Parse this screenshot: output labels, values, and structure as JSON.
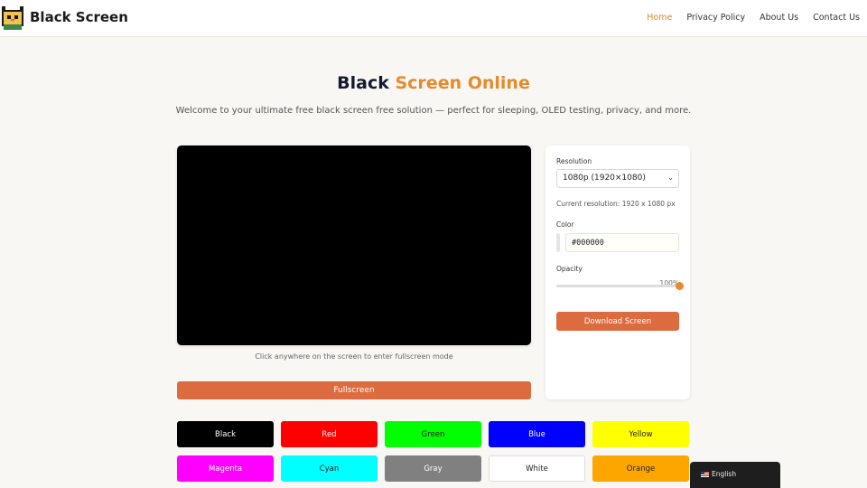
{
  "header": {
    "brand": "Black Screen",
    "nav": [
      {
        "label": "Home",
        "active": true
      },
      {
        "label": "Privacy Policy",
        "active": false
      },
      {
        "label": "About Us",
        "active": false
      },
      {
        "label": "Contact Us",
        "active": false
      }
    ]
  },
  "hero": {
    "title_main": "Black",
    "title_accent": "Screen Online",
    "subtitle": "Welcome to your ultimate free black screen free solution — perfect for sleeping, OLED testing, privacy, and more."
  },
  "preview": {
    "color": "#000000",
    "hint": "Click anywhere on the screen to enter fullscreen mode",
    "fullscreen_label": "Fullscreen"
  },
  "controls": {
    "resolution_label": "Resolution",
    "resolution_value": "1080p (1920×1080)",
    "current_resolution": "Current resolution: 1920 x 1080 px",
    "color_label": "Color",
    "color_value": "#000000",
    "opacity_label": "Opacity",
    "opacity_value": "100%",
    "opacity_fraction": 1.0,
    "download_label": "Download Screen"
  },
  "color_buttons": [
    {
      "label": "Black",
      "bg": "#000000",
      "fg": "#ffffff"
    },
    {
      "label": "Red",
      "bg": "#ff0000",
      "fg": "#ffffff"
    },
    {
      "label": "Green",
      "bg": "#00ff00",
      "fg": "#222222"
    },
    {
      "label": "Blue",
      "bg": "#0000ff",
      "fg": "#ffffff"
    },
    {
      "label": "Yellow",
      "bg": "#ffff00",
      "fg": "#222222"
    },
    {
      "label": "Magenta",
      "bg": "#ff00ff",
      "fg": "#ffffff"
    },
    {
      "label": "Cyan",
      "bg": "#00ffff",
      "fg": "#222222"
    },
    {
      "label": "Gray",
      "bg": "#808080",
      "fg": "#ffffff"
    },
    {
      "label": "White",
      "bg": "#ffffff",
      "fg": "#222222"
    },
    {
      "label": "Orange",
      "bg": "#ffa500",
      "fg": "#222222"
    }
  ],
  "language": {
    "label": "English",
    "icon": "us-flag-icon"
  },
  "colors": {
    "accent": "#e58a2e",
    "button": "#dd6b40",
    "background": "#f8f7f3"
  }
}
